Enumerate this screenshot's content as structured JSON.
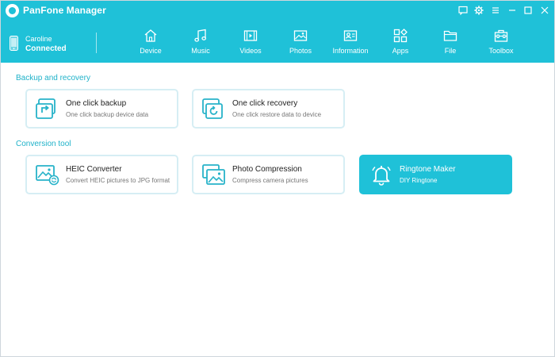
{
  "app": {
    "title": "PanFone Manager"
  },
  "device": {
    "name": "Caroline",
    "status": "Connected"
  },
  "nav": [
    {
      "label": "Device",
      "icon": "home-icon"
    },
    {
      "label": "Music",
      "icon": "music-icon"
    },
    {
      "label": "Videos",
      "icon": "video-icon"
    },
    {
      "label": "Photos",
      "icon": "photo-icon"
    },
    {
      "label": "Information",
      "icon": "contact-card-icon"
    },
    {
      "label": "Apps",
      "icon": "apps-icon"
    },
    {
      "label": "File",
      "icon": "folder-icon"
    },
    {
      "label": "Toolbox",
      "icon": "toolbox-icon"
    }
  ],
  "sections": {
    "backup": {
      "title": "Backup and recovery",
      "cards": [
        {
          "title": "One click backup",
          "desc": "One click backup device data",
          "icon": "backup-icon"
        },
        {
          "title": "One click recovery",
          "desc": "One click restore data to device",
          "icon": "recovery-icon"
        }
      ]
    },
    "conversion": {
      "title": "Conversion tool",
      "cards": [
        {
          "title": "HEIC Converter",
          "desc": "Convert HEIC pictures to JPG format",
          "icon": "heic-convert-icon"
        },
        {
          "title": "Photo Compression",
          "desc": "Compress camera pictures",
          "icon": "photo-compress-icon"
        },
        {
          "title": "Ringtone Maker",
          "desc": "DIY Ringtone",
          "icon": "bell-icon",
          "active": true
        }
      ]
    }
  },
  "colors": {
    "accent": "#1fc1d8",
    "section_title": "#1fb2c9",
    "card_border": "#d6eef4",
    "icon": "#27b3c9"
  }
}
